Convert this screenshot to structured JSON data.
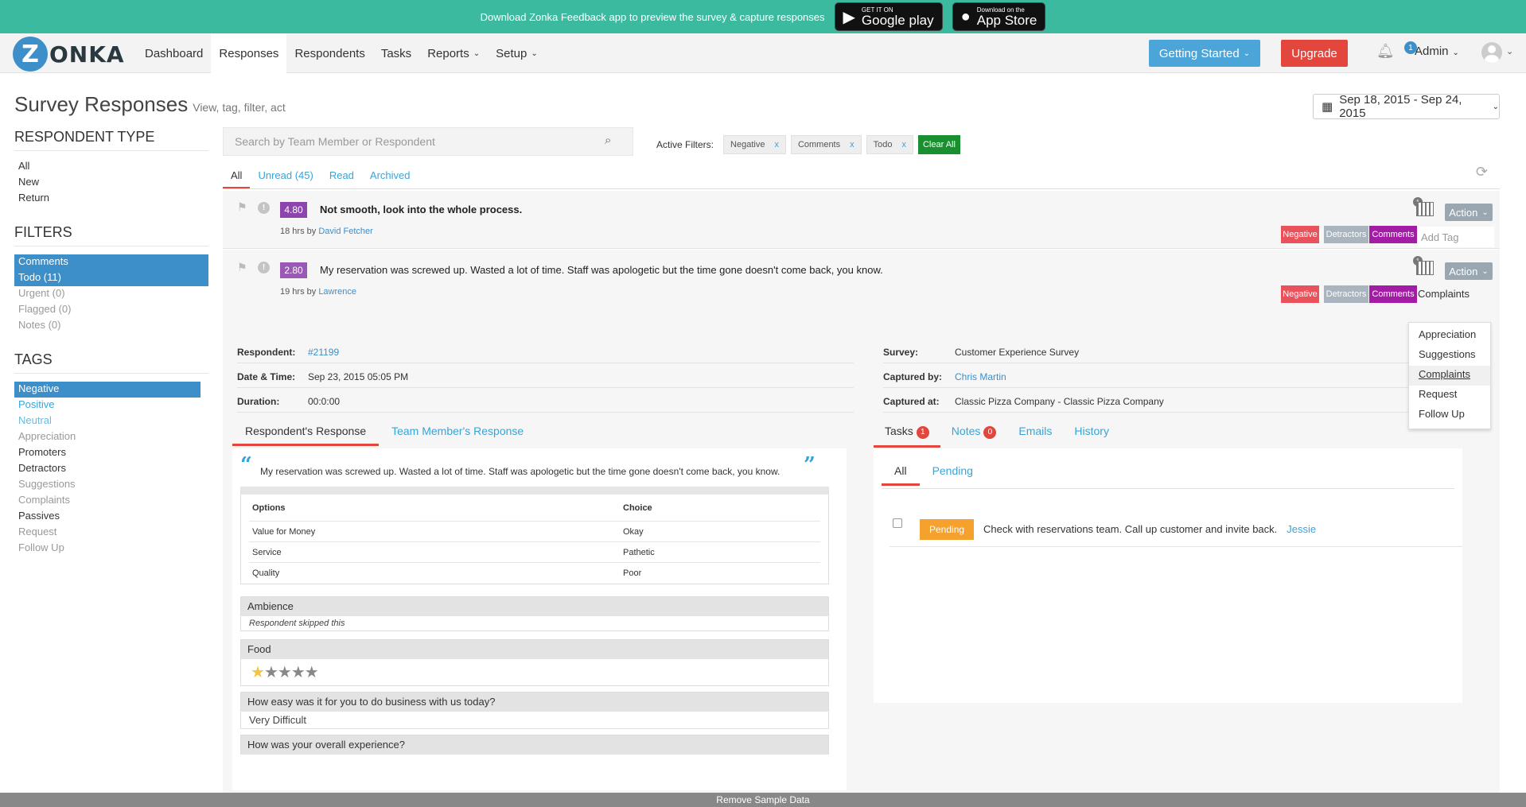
{
  "promo": {
    "text": "Download Zonka Feedback app to preview the survey & capture responses",
    "google_small": "GET IT ON",
    "google_big": "Google play",
    "apple_small": "Download on the",
    "apple_big": "App Store"
  },
  "nav": {
    "logo": "ZONKA",
    "logo_letter": "Z",
    "items": [
      {
        "label": "Dashboard"
      },
      {
        "label": "Responses",
        "active": true
      },
      {
        "label": "Respondents"
      },
      {
        "label": "Tasks"
      },
      {
        "label": "Reports",
        "caret": true
      },
      {
        "label": "Setup",
        "caret": true
      }
    ],
    "getting_started": "Getting Started",
    "upgrade": "Upgrade",
    "notif_count": "1",
    "admin": "Admin"
  },
  "page": {
    "title": "Survey Responses",
    "subtitle": "View, tag, filter, act",
    "date_range": "Sep 18, 2015 - Sep 24, 2015"
  },
  "sidebar": {
    "respondent_type": {
      "heading": "RESPONDENT TYPE",
      "items": [
        "All",
        "New",
        "Return"
      ]
    },
    "filters": {
      "heading": "FILTERS",
      "items": [
        "Comments",
        "Todo (11)",
        "Urgent (0)",
        "Flagged (0)",
        "Notes (0)"
      ]
    },
    "tags": {
      "heading": "TAGS",
      "items": [
        "Negative",
        "Positive",
        "Neutral",
        "Appreciation",
        "Promoters",
        "Detractors",
        "Suggestions",
        "Complaints",
        "Passives",
        "Request",
        "Follow Up"
      ]
    }
  },
  "search": {
    "placeholder": "Search by Team Member or Respondent"
  },
  "active_filters": {
    "label": "Active Filters:",
    "chips": [
      "Negative",
      "Comments",
      "Todo"
    ],
    "remove": "x",
    "clear_all": "Clear All"
  },
  "tabs": [
    "All",
    "Unread (45)",
    "Read",
    "Archived"
  ],
  "responses": [
    {
      "score": "4.80",
      "score_color": "#8e44ad",
      "text": "Not smooth, look into the whole process.",
      "time": "18 hrs by",
      "author": "David Fetcher",
      "tags": [
        "Negative",
        "Detractors",
        "Comments"
      ],
      "add_tag": "Add Tag",
      "action": "Action",
      "cal_badge": "1"
    },
    {
      "score": "2.80",
      "score_color": "#9b59b6",
      "text": "My reservation was screwed up. Wasted a lot of time. Staff was apologetic but the time gone doesn't come back, you know.",
      "time": "19 hrs by",
      "author": "Lawrence",
      "tags": [
        "Negative",
        "Detractors",
        "Comments"
      ],
      "tag_input": "Complaints",
      "action": "Action",
      "cal_badge": "1"
    }
  ],
  "tag_colors": {
    "Negative": "#e9515b",
    "Detractors": "#aab4be",
    "Comments": "#a21ca6"
  },
  "dropdown": [
    "Appreciation",
    "Suggestions",
    "Complaints",
    "Request",
    "Follow Up"
  ],
  "details": {
    "respondent_label": "Respondent:",
    "respondent": "#21199",
    "datetime_label": "Date & Time:",
    "datetime": "Sep 23, 2015 05:05 PM",
    "duration_label": "Duration:",
    "duration": "00:0:00",
    "survey_label": "Survey:",
    "survey": "Customer Experience Survey",
    "captured_by_label": "Captured by:",
    "captured_by": "Chris Martin",
    "captured_at_label": "Captured at:",
    "captured_at": "Classic Pizza Company - Classic Pizza Company",
    "left_tabs": [
      "Respondent's Response",
      "Team Member's Response"
    ],
    "right_tabs": [
      {
        "label": "Tasks",
        "count": "1"
      },
      {
        "label": "Notes",
        "count": "0"
      },
      {
        "label": "Emails"
      },
      {
        "label": "History"
      }
    ],
    "quote": "My reservation was screwed up. Wasted a lot of time. Staff was apologetic but the time gone doesn't come back, you know.",
    "options_header": [
      "Options",
      "Choice"
    ],
    "options": [
      [
        "Value for Money",
        "Okay"
      ],
      [
        "Service",
        "Pathetic"
      ],
      [
        "Quality",
        "Poor"
      ]
    ],
    "questions": [
      {
        "q": "Ambience",
        "a": "Respondent skipped this"
      },
      {
        "q": "Food",
        "rating": 1,
        "max": 5
      },
      {
        "q": "How easy was it for you to do business with us today?",
        "a": "Very Difficult"
      },
      {
        "q": "How was your overall experience?"
      }
    ],
    "task_tabs": [
      "All",
      "Pending"
    ],
    "task": {
      "status": "Pending",
      "text": "Check with reservations team. Call up customer and invite back.",
      "assignee": "Jessie"
    }
  },
  "remove_sample": "Remove Sample Data"
}
